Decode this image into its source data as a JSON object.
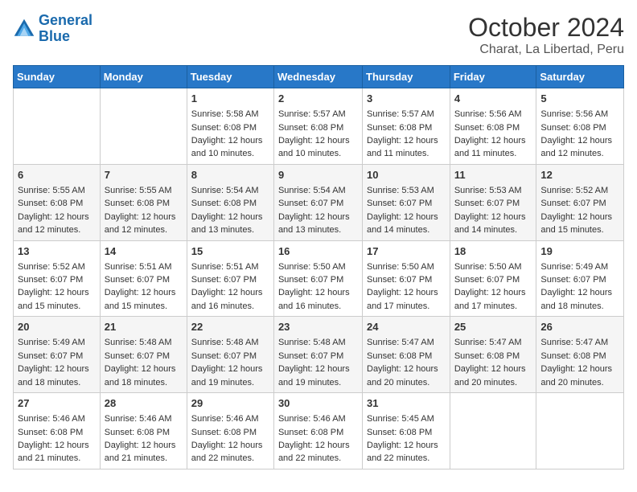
{
  "logo": {
    "line1": "General",
    "line2": "Blue"
  },
  "title": "October 2024",
  "subtitle": "Charat, La Libertad, Peru",
  "days_header": [
    "Sunday",
    "Monday",
    "Tuesday",
    "Wednesday",
    "Thursday",
    "Friday",
    "Saturday"
  ],
  "weeks": [
    [
      {
        "day": "",
        "detail": ""
      },
      {
        "day": "",
        "detail": ""
      },
      {
        "day": "1",
        "detail": "Sunrise: 5:58 AM\nSunset: 6:08 PM\nDaylight: 12 hours and 10 minutes."
      },
      {
        "day": "2",
        "detail": "Sunrise: 5:57 AM\nSunset: 6:08 PM\nDaylight: 12 hours and 10 minutes."
      },
      {
        "day": "3",
        "detail": "Sunrise: 5:57 AM\nSunset: 6:08 PM\nDaylight: 12 hours and 11 minutes."
      },
      {
        "day": "4",
        "detail": "Sunrise: 5:56 AM\nSunset: 6:08 PM\nDaylight: 12 hours and 11 minutes."
      },
      {
        "day": "5",
        "detail": "Sunrise: 5:56 AM\nSunset: 6:08 PM\nDaylight: 12 hours and 12 minutes."
      }
    ],
    [
      {
        "day": "6",
        "detail": "Sunrise: 5:55 AM\nSunset: 6:08 PM\nDaylight: 12 hours and 12 minutes."
      },
      {
        "day": "7",
        "detail": "Sunrise: 5:55 AM\nSunset: 6:08 PM\nDaylight: 12 hours and 12 minutes."
      },
      {
        "day": "8",
        "detail": "Sunrise: 5:54 AM\nSunset: 6:08 PM\nDaylight: 12 hours and 13 minutes."
      },
      {
        "day": "9",
        "detail": "Sunrise: 5:54 AM\nSunset: 6:07 PM\nDaylight: 12 hours and 13 minutes."
      },
      {
        "day": "10",
        "detail": "Sunrise: 5:53 AM\nSunset: 6:07 PM\nDaylight: 12 hours and 14 minutes."
      },
      {
        "day": "11",
        "detail": "Sunrise: 5:53 AM\nSunset: 6:07 PM\nDaylight: 12 hours and 14 minutes."
      },
      {
        "day": "12",
        "detail": "Sunrise: 5:52 AM\nSunset: 6:07 PM\nDaylight: 12 hours and 15 minutes."
      }
    ],
    [
      {
        "day": "13",
        "detail": "Sunrise: 5:52 AM\nSunset: 6:07 PM\nDaylight: 12 hours and 15 minutes."
      },
      {
        "day": "14",
        "detail": "Sunrise: 5:51 AM\nSunset: 6:07 PM\nDaylight: 12 hours and 15 minutes."
      },
      {
        "day": "15",
        "detail": "Sunrise: 5:51 AM\nSunset: 6:07 PM\nDaylight: 12 hours and 16 minutes."
      },
      {
        "day": "16",
        "detail": "Sunrise: 5:50 AM\nSunset: 6:07 PM\nDaylight: 12 hours and 16 minutes."
      },
      {
        "day": "17",
        "detail": "Sunrise: 5:50 AM\nSunset: 6:07 PM\nDaylight: 12 hours and 17 minutes."
      },
      {
        "day": "18",
        "detail": "Sunrise: 5:50 AM\nSunset: 6:07 PM\nDaylight: 12 hours and 17 minutes."
      },
      {
        "day": "19",
        "detail": "Sunrise: 5:49 AM\nSunset: 6:07 PM\nDaylight: 12 hours and 18 minutes."
      }
    ],
    [
      {
        "day": "20",
        "detail": "Sunrise: 5:49 AM\nSunset: 6:07 PM\nDaylight: 12 hours and 18 minutes."
      },
      {
        "day": "21",
        "detail": "Sunrise: 5:48 AM\nSunset: 6:07 PM\nDaylight: 12 hours and 18 minutes."
      },
      {
        "day": "22",
        "detail": "Sunrise: 5:48 AM\nSunset: 6:07 PM\nDaylight: 12 hours and 19 minutes."
      },
      {
        "day": "23",
        "detail": "Sunrise: 5:48 AM\nSunset: 6:07 PM\nDaylight: 12 hours and 19 minutes."
      },
      {
        "day": "24",
        "detail": "Sunrise: 5:47 AM\nSunset: 6:08 PM\nDaylight: 12 hours and 20 minutes."
      },
      {
        "day": "25",
        "detail": "Sunrise: 5:47 AM\nSunset: 6:08 PM\nDaylight: 12 hours and 20 minutes."
      },
      {
        "day": "26",
        "detail": "Sunrise: 5:47 AM\nSunset: 6:08 PM\nDaylight: 12 hours and 20 minutes."
      }
    ],
    [
      {
        "day": "27",
        "detail": "Sunrise: 5:46 AM\nSunset: 6:08 PM\nDaylight: 12 hours and 21 minutes."
      },
      {
        "day": "28",
        "detail": "Sunrise: 5:46 AM\nSunset: 6:08 PM\nDaylight: 12 hours and 21 minutes."
      },
      {
        "day": "29",
        "detail": "Sunrise: 5:46 AM\nSunset: 6:08 PM\nDaylight: 12 hours and 22 minutes."
      },
      {
        "day": "30",
        "detail": "Sunrise: 5:46 AM\nSunset: 6:08 PM\nDaylight: 12 hours and 22 minutes."
      },
      {
        "day": "31",
        "detail": "Sunrise: 5:45 AM\nSunset: 6:08 PM\nDaylight: 12 hours and 22 minutes."
      },
      {
        "day": "",
        "detail": ""
      },
      {
        "day": "",
        "detail": ""
      }
    ]
  ]
}
